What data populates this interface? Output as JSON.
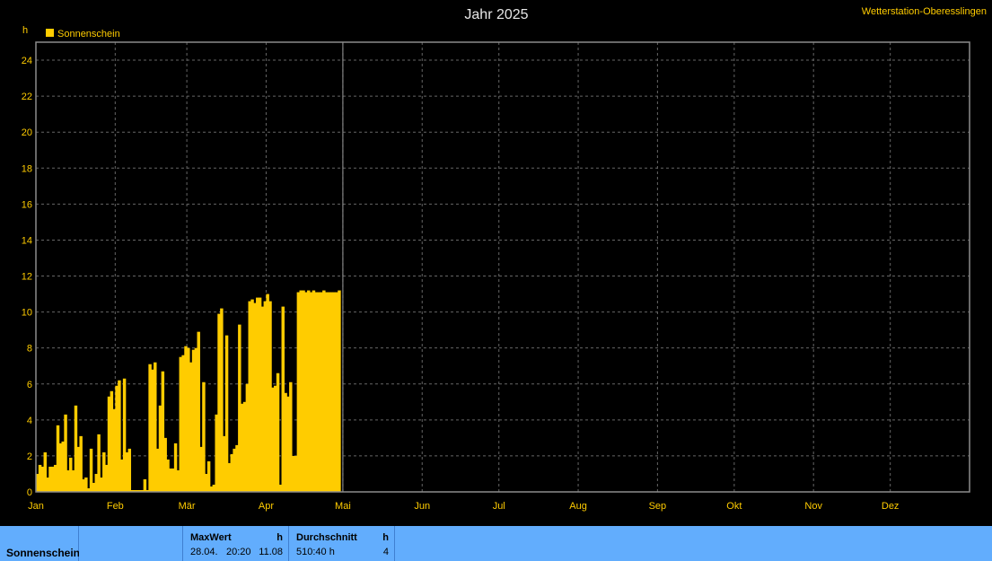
{
  "title": "Jahr 2025",
  "station": "Wetterstation-Oberesslingen",
  "colors": {
    "bar": "#ffcc00",
    "grid": "#666666",
    "axisText": "#ffcc00",
    "background": "#000000",
    "footer": "#62adfd"
  },
  "chart_data": {
    "type": "bar",
    "title": "Jahr 2025",
    "ylabel": "h",
    "ylim": [
      0,
      25
    ],
    "yticks": [
      "0",
      "2",
      "4",
      "6",
      "8",
      "10",
      "12",
      "14",
      "16",
      "18",
      "20",
      "22",
      "24"
    ],
    "xticks": [
      "Jan",
      "Feb",
      "Mär",
      "Apr",
      "Mai",
      "Jun",
      "Jul",
      "Aug",
      "Sep",
      "Okt",
      "Nov",
      "Dez"
    ],
    "xdomain_days": 365,
    "grid": true,
    "legend": "top-left",
    "series": [
      {
        "name": "Sonnenschein",
        "values": [
          1.0,
          1.5,
          1.4,
          2.2,
          0.8,
          1.4,
          1.4,
          1.5,
          3.7,
          2.7,
          2.8,
          4.3,
          1.2,
          1.9,
          1.2,
          4.8,
          2.5,
          3.1,
          0.7,
          0.8,
          0.2,
          2.4,
          0.5,
          1.0,
          3.2,
          0.8,
          2.2,
          1.5,
          5.3,
          5.6,
          4.6,
          5.9,
          6.2,
          1.8,
          6.3,
          2.2,
          2.4,
          0.1,
          0.1,
          0.1,
          0.1,
          0.1,
          0.7,
          0.1,
          7.1,
          6.8,
          7.2,
          2.4,
          4.8,
          6.7,
          3.0,
          1.8,
          1.3,
          1.3,
          2.7,
          1.2,
          7.5,
          7.6,
          8.1,
          8.0,
          7.2,
          7.9,
          8.0,
          8.9,
          2.5,
          6.1,
          1.0,
          1.7,
          0.3,
          0.4,
          4.3,
          9.9,
          10.2,
          3.1,
          8.7,
          1.6,
          2.1,
          2.4,
          2.6,
          9.3,
          4.9,
          5.0,
          6.0,
          10.6,
          10.7,
          10.5,
          10.8,
          10.8,
          10.3,
          10.6,
          11.0,
          10.6,
          5.8,
          5.9,
          6.6,
          0.4,
          10.3,
          5.5,
          5.3,
          6.1,
          2.0,
          2.0,
          11.1,
          11.2,
          11.2,
          11.1,
          11.2,
          11.1,
          11.2,
          11.1,
          11.1,
          11.1,
          11.2,
          11.1,
          11.1,
          11.1,
          11.1,
          11.1,
          11.2,
          0.0
        ]
      }
    ]
  },
  "footer": {
    "row_label": "Sonnenschein",
    "max_label": "MaxWert",
    "max_unit": "h",
    "max_date": "28.04.",
    "max_time": "20:20",
    "max_value": "11.08",
    "avg_label": "Durchschnitt",
    "avg_unit": "h",
    "avg_value": "510:40 h",
    "avg_count": "4"
  }
}
